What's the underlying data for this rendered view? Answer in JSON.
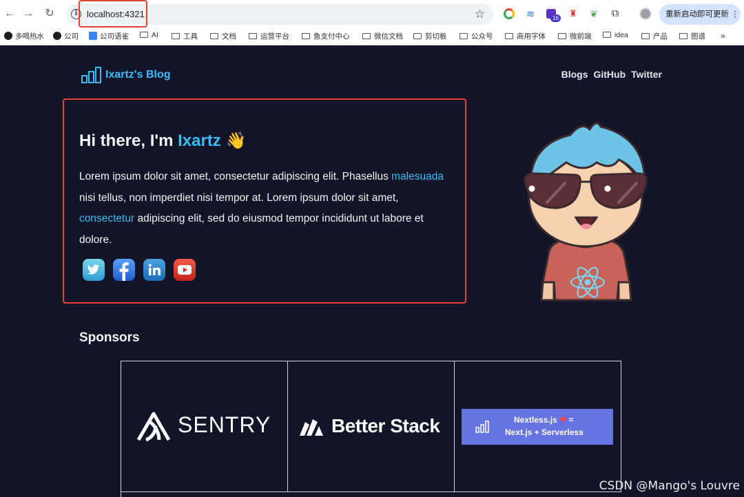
{
  "browser": {
    "url": "localhost:4321",
    "update_label": "重新启动即可更新",
    "ext_badge": "16",
    "bookmarks": [
      "多喝热水",
      "公司",
      "公司语雀",
      "AI",
      "工具",
      "文档",
      "运营平台",
      "鱼支付中心",
      "微信文档",
      "剪切板",
      "公众号",
      "商用字体",
      "微前端",
      "idea",
      "产品",
      "图谱"
    ]
  },
  "site": {
    "logo_text": "Ixartz's Blog",
    "nav": [
      "Blogs",
      "GitHub",
      "Twitter"
    ]
  },
  "hero": {
    "title_prefix": "Hi there, I'm ",
    "title_name": "Ixartz",
    "title_emoji": "👋",
    "p1": "Lorem ipsum dolor sit amet, consectetur adipiscing elit. Phasellus ",
    "link1": "malesuada",
    "p2": " nisi tellus, non imperdiet nisi tempor at. Lorem ipsum dolor sit amet, ",
    "link2": "consectetur",
    "p3": " adipiscing elit, sed do eiusmod tempor incididunt ut labore et dolore.",
    "socials": [
      "twitter-icon",
      "facebook-icon",
      "linkedin-icon",
      "youtube-icon"
    ]
  },
  "sponsors": {
    "title": "Sponsors",
    "items": [
      {
        "name": "SENTRY"
      },
      {
        "name": "Better Stack"
      },
      {
        "line1": "Nextless.js",
        "heart": "❤",
        "eq": "=",
        "line2": "Next.js + Serverless"
      }
    ]
  },
  "watermark": "CSDN @Mango's Louvre",
  "colors": {
    "accent": "#38bdf8",
    "background": "#111527",
    "highlight_box": "#e0442c",
    "nextless_bg": "#6674e2"
  }
}
